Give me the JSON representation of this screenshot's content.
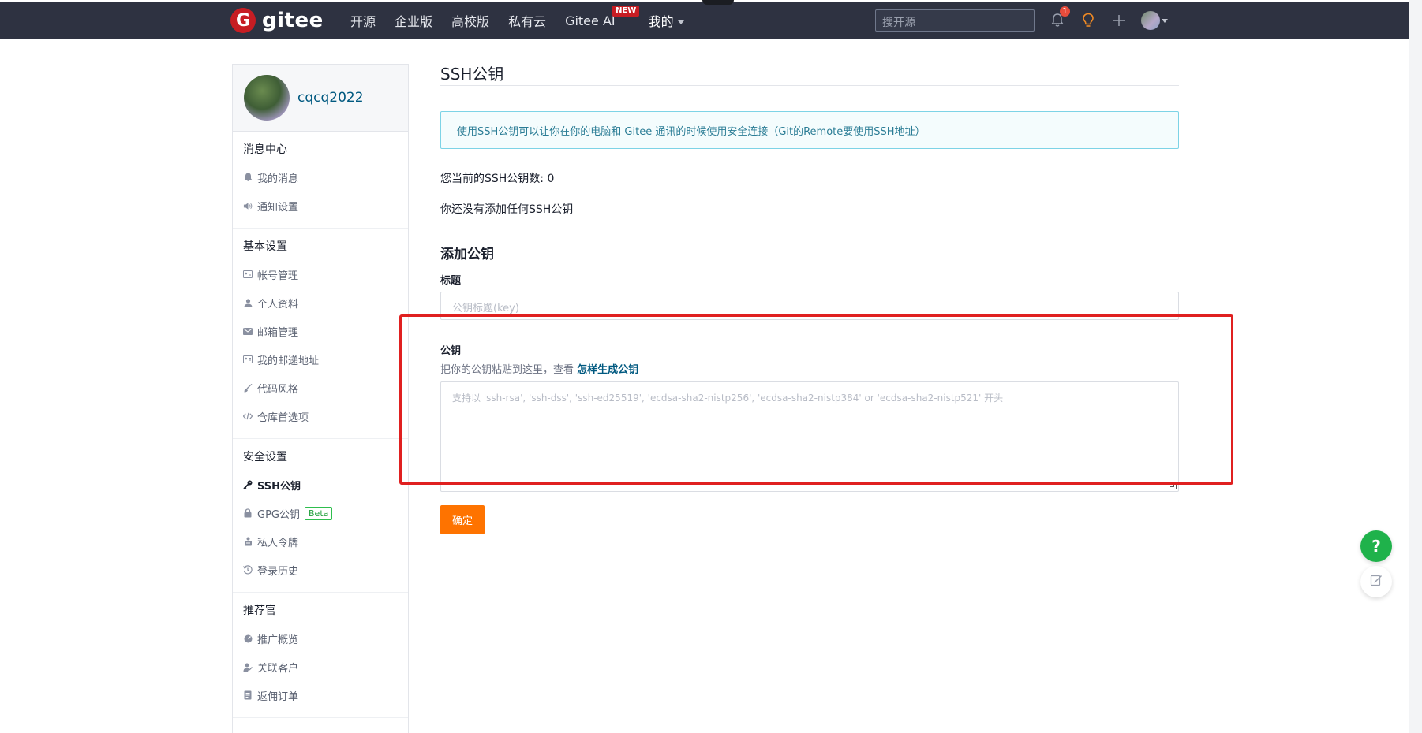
{
  "nav": {
    "brand": "gitee",
    "logo_letter": "G",
    "links": [
      "开源",
      "企业版",
      "高校版",
      "私有云",
      "Gitee AI",
      "我的"
    ],
    "new_badge": "NEW",
    "search_placeholder": "搜开源",
    "notification_count": "1"
  },
  "sidebar": {
    "username": "cqcq2022",
    "groups": [
      {
        "title": "消息中心",
        "items": [
          {
            "label": "我的消息",
            "icon": "bell-icon"
          },
          {
            "label": "通知设置",
            "icon": "speaker-icon"
          }
        ]
      },
      {
        "title": "基本设置",
        "items": [
          {
            "label": "帐号管理",
            "icon": "id-card-icon"
          },
          {
            "label": "个人资料",
            "icon": "user-icon"
          },
          {
            "label": "邮箱管理",
            "icon": "mail-icon"
          },
          {
            "label": "我的邮递地址",
            "icon": "address-card-icon"
          },
          {
            "label": "代码风格",
            "icon": "brush-icon"
          },
          {
            "label": "仓库首选项",
            "icon": "code-icon"
          }
        ]
      },
      {
        "title": "安全设置",
        "items": [
          {
            "label": "SSH公钥",
            "icon": "key-icon",
            "active": true
          },
          {
            "label": "GPG公钥",
            "icon": "lock-icon",
            "badge": "Beta"
          },
          {
            "label": "私人令牌",
            "icon": "token-icon"
          },
          {
            "label": "登录历史",
            "icon": "history-icon"
          }
        ]
      },
      {
        "title": "推荐官",
        "items": [
          {
            "label": "推广概览",
            "icon": "dashboard-icon"
          },
          {
            "label": "关联客户",
            "icon": "user-link-icon"
          },
          {
            "label": "返佣订单",
            "icon": "order-icon"
          }
        ]
      }
    ]
  },
  "main": {
    "title": "SSH公钥",
    "info": "使用SSH公钥可以让你在你的电脑和 Gitee 通讯的时候使用安全连接（Git的Remote要使用SSH地址）",
    "count_text": "您当前的SSH公钥数: 0",
    "none_text": "你还没有添加任何SSH公钥",
    "add_heading": "添加公钥",
    "title_label": "标题",
    "title_placeholder": "公钥标题(key)",
    "key_label": "公钥",
    "key_hint": "把你的公钥粘贴到这里，查看 ",
    "key_hint_link": "怎样生成公钥",
    "key_placeholder": "支持以 'ssh-rsa', 'ssh-dss', 'ssh-ed25519', 'ecdsa-sha2-nistp256', 'ecdsa-sha2-nistp384' or 'ecdsa-sha2-nistp521' 开头",
    "submit": "确定"
  },
  "float": {
    "help": "?"
  },
  "colors": {
    "nav_bg": "#2e3241",
    "brand_red": "#c71d23",
    "submit_orange": "#fe7300",
    "link_blue": "#005980",
    "highlight_red": "#e02020",
    "help_green": "#1fb24b"
  }
}
